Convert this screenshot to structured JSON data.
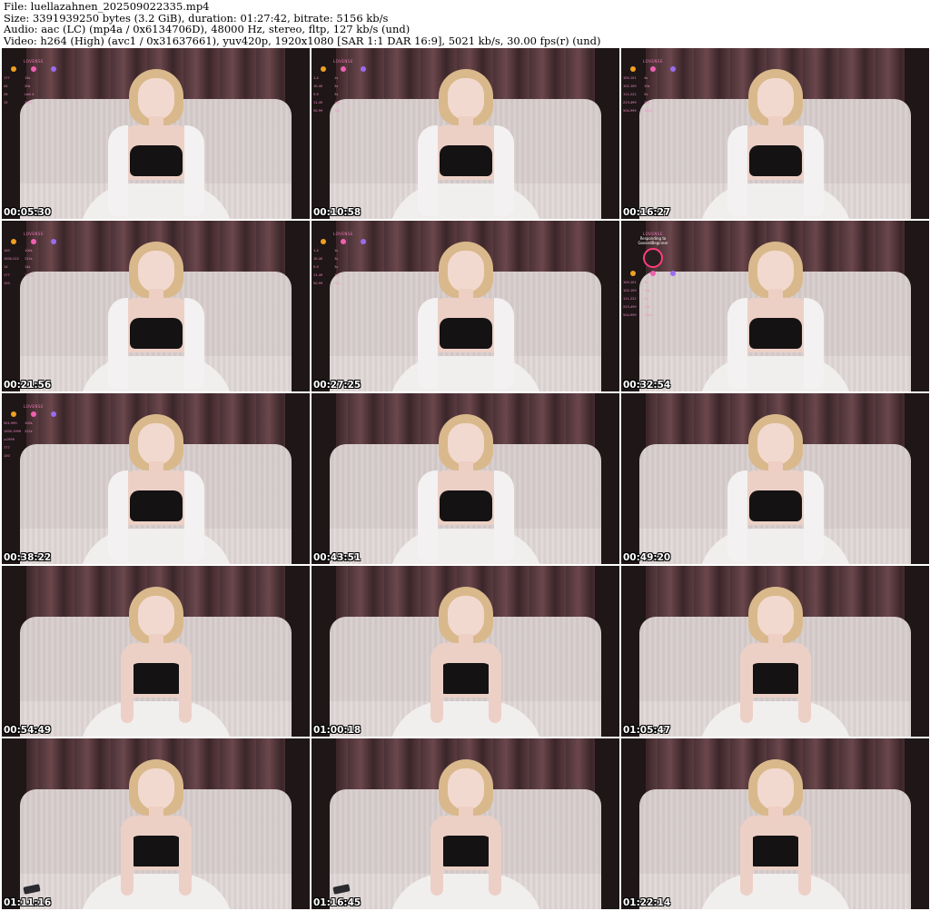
{
  "header": {
    "line1": "File: luellazahnen_202509022335.mp4",
    "line2": "Size: 3391939250 bytes (3.2 GiB), duration: 01:27:42, bitrate: 5156 kb/s",
    "line3": "Audio: aac (LC) (mp4a / 0x6134706D), 48000 Hz, stereo, fltp, 127 kb/s (und)",
    "line4": "Video: h264 (High) (avc1 / 0x31637661), yuv420p, 1920x1080 [SAR 1:1 DAR 16:9], 5021 kb/s, 30.00 fps(r) (und)"
  },
  "overlay": {
    "brand": "LOVENSE",
    "responding_label": "Responding to",
    "user": "GoosedBeginner",
    "dot_colors": [
      "#f0a020",
      "#f060b0",
      "#9a6cf0"
    ],
    "rows_a": [
      [
        "177",
        "15s",
        ""
      ],
      [
        "44",
        "20s",
        ""
      ],
      [
        "26",
        "Levl 4",
        ""
      ],
      [
        "15",
        "3-44",
        ""
      ]
    ],
    "rows_b": [
      [
        "1-4",
        "1s",
        ""
      ],
      [
        "10-40",
        "3s",
        ""
      ],
      [
        "5-9",
        "3s",
        ""
      ],
      [
        "11-49",
        "10s",
        ""
      ],
      [
        "50-99",
        "30s",
        ""
      ]
    ],
    "rows_c": [
      [
        "100-101",
        "4s",
        ""
      ],
      [
        "102-109",
        "10s",
        ""
      ],
      [
        "111-222",
        "5s",
        ""
      ],
      [
        "223-499",
        "30s",
        ""
      ],
      [
        "504-999",
        "300s",
        ""
      ]
    ],
    "rows_d": [
      [
        "100",
        "100s",
        ""
      ],
      [
        "1000-222",
        "222s",
        ""
      ],
      [
        "14",
        "14s",
        ""
      ],
      [
        "177",
        "177s",
        ""
      ],
      [
        "120",
        "",
        ""
      ]
    ],
    "rows_e": [
      [
        "100-101",
        "4s",
        ""
      ],
      [
        "102-109",
        "10s",
        ""
      ],
      [
        "111-222",
        "5s",
        ""
      ],
      [
        "223-499",
        "30s",
        ""
      ],
      [
        "504-999",
        "300s",
        ""
      ]
    ],
    "rows_f": [
      [
        "501-999",
        "100s",
        ""
      ],
      [
        "1000-1999",
        "222s",
        ""
      ],
      [
        "≥1999",
        "",
        ""
      ],
      [
        "777",
        "",
        ""
      ],
      [
        "100",
        "",
        ""
      ]
    ]
  },
  "frames": [
    {
      "time": "00:05:30"
    },
    {
      "time": "00:10:58"
    },
    {
      "time": "00:16:27"
    },
    {
      "time": "00:21:56"
    },
    {
      "time": "00:27:25"
    },
    {
      "time": "00:32:54"
    },
    {
      "time": "00:38:22"
    },
    {
      "time": "00:43:51"
    },
    {
      "time": "00:49:20"
    },
    {
      "time": "00:54:49"
    },
    {
      "time": "01:00:18"
    },
    {
      "time": "01:05:47"
    },
    {
      "time": "01:11:16"
    },
    {
      "time": "01:16:45"
    },
    {
      "time": "01:22:14"
    }
  ],
  "colors": {
    "timestamp_text": "#ffffff",
    "overlay_pink": "#f58cc8",
    "couch": "#d8cfce",
    "curtain": "#5a3b40"
  }
}
